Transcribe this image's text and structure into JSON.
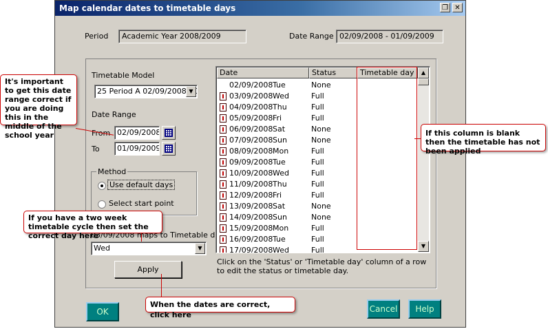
{
  "window": {
    "title": "Map calendar dates to timetable days",
    "restore_glyph": "❐",
    "close_glyph": "✕"
  },
  "period": {
    "label": "Period",
    "value": "Academic Year 2008/2009"
  },
  "date_range_top": {
    "label": "Date Range",
    "value": "02/09/2008 - 01/09/2009"
  },
  "timetable_model": {
    "label": "Timetable Model",
    "value": "25 Period A 02/09/2008 - 0"
  },
  "date_range": {
    "label": "Date Range",
    "from_label": "From",
    "from_value": "02/09/2008",
    "to_label": "To",
    "to_value": "01/09/2009"
  },
  "method": {
    "label": "Method",
    "options": [
      "Use default days",
      "Select start point"
    ],
    "selected": "Use default days"
  },
  "maps_to": {
    "label": "03/09/2008  maps to Timetable day:",
    "value": "Wed"
  },
  "buttons": {
    "apply": "Apply",
    "ok": "OK",
    "cancel": "Cancel",
    "help": "Help"
  },
  "table": {
    "columns": [
      "Date",
      "Status",
      "Timetable day"
    ],
    "rows": [
      {
        "date": "02/09/2008",
        "day": "Tue",
        "status": "None",
        "icon": false
      },
      {
        "date": "03/09/2008",
        "day": "Wed",
        "status": "Full",
        "icon": true
      },
      {
        "date": "04/09/2008",
        "day": "Thu",
        "status": "Full",
        "icon": true
      },
      {
        "date": "05/09/2008",
        "day": "Fri",
        "status": "Full",
        "icon": true
      },
      {
        "date": "06/09/2008",
        "day": "Sat",
        "status": "None",
        "icon": true
      },
      {
        "date": "07/09/2008",
        "day": "Sun",
        "status": "None",
        "icon": true
      },
      {
        "date": "08/09/2008",
        "day": "Mon",
        "status": "Full",
        "icon": true
      },
      {
        "date": "09/09/2008",
        "day": "Tue",
        "status": "Full",
        "icon": true
      },
      {
        "date": "10/09/2008",
        "day": "Wed",
        "status": "Full",
        "icon": true
      },
      {
        "date": "11/09/2008",
        "day": "Thu",
        "status": "Full",
        "icon": true
      },
      {
        "date": "12/09/2008",
        "day": "Fri",
        "status": "Full",
        "icon": true
      },
      {
        "date": "13/09/2008",
        "day": "Sat",
        "status": "None",
        "icon": true
      },
      {
        "date": "14/09/2008",
        "day": "Sun",
        "status": "None",
        "icon": true
      },
      {
        "date": "15/09/2008",
        "day": "Mon",
        "status": "Full",
        "icon": true
      },
      {
        "date": "16/09/2008",
        "day": "Tue",
        "status": "Full",
        "icon": true
      },
      {
        "date": "17/09/2008",
        "day": "Wed",
        "status": "Full",
        "icon": true
      }
    ]
  },
  "hint": "Click on the 'Status' or 'Timetable day' column of a row to edit the status or timetable day.",
  "callouts": {
    "date_range": "It's important to get this date range correct if you are doing this in the middle of the school year",
    "column_blank": "If this column is blank then the timetable has not been applied",
    "week_cycle": "If you have a two week timetable cycle then set the correct day here",
    "dates_correct": "When the dates are correct, click here"
  },
  "colors": {
    "teal_button": "#008080",
    "callout_border": "#cc0000",
    "title_start": "#0a246a"
  }
}
